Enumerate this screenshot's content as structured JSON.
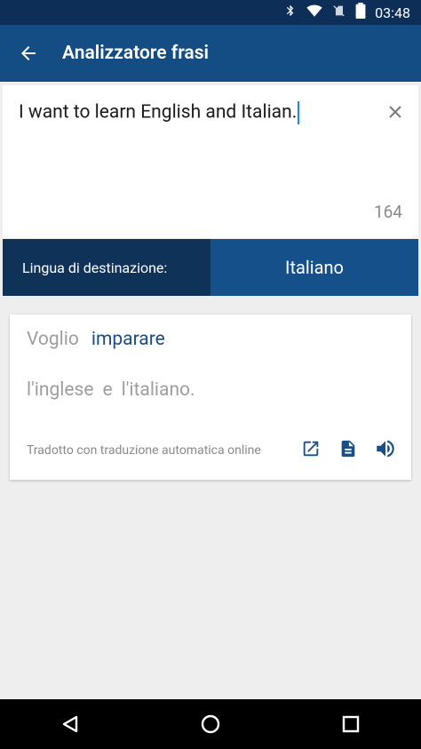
{
  "status_bar": {
    "time": "03:48"
  },
  "app_bar": {
    "title": "Analizzatore frasi"
  },
  "input": {
    "text": "I want to learn English and Italian.",
    "char_count": "164"
  },
  "language": {
    "label": "Lingua di destinazione:",
    "value": "Italiano"
  },
  "result": {
    "line1": [
      "Voglio",
      "imparare"
    ],
    "line2": [
      "l'inglese",
      "e",
      "l'italiano."
    ],
    "note": "Tradotto con traduzione automatica online"
  },
  "colors": {
    "primary": "#134d84",
    "primary_dark": "#0e3258",
    "accent_text": "#1a4f86"
  }
}
